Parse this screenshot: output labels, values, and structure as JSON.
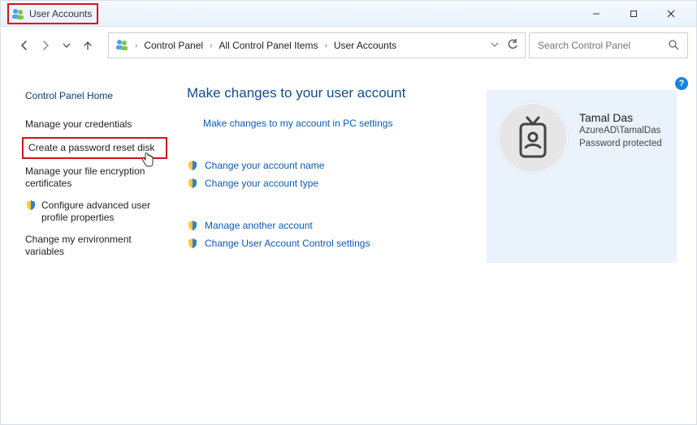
{
  "window": {
    "title": "User Accounts"
  },
  "breadcrumb": {
    "root": "Control Panel",
    "mid": "All Control Panel Items",
    "leaf": "User Accounts"
  },
  "search": {
    "placeholder": "Search Control Panel"
  },
  "sidebar": {
    "home": "Control Panel Home",
    "items": [
      "Manage your credentials",
      "Create a password reset disk",
      "Manage your file encryption certificates",
      "Configure advanced user profile properties",
      "Change my environment variables"
    ]
  },
  "main": {
    "heading": "Make changes to your user account",
    "pc_settings_link": "Make changes to my account in PC settings",
    "change_name": "Change your account name",
    "change_type": "Change your account type",
    "manage_another": "Manage another account",
    "uac_settings": "Change User Account Control settings"
  },
  "user": {
    "name": "Tamal Das",
    "domain": "AzureAD\\TamalDas",
    "status": "Password protected"
  }
}
